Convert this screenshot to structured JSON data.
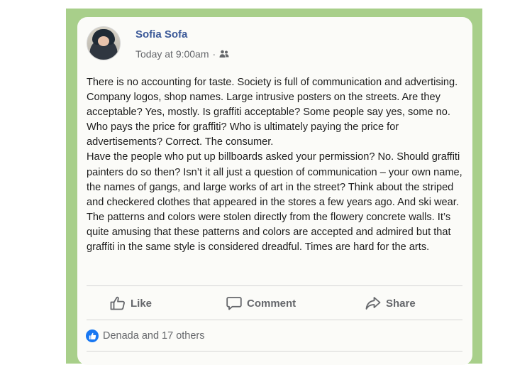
{
  "post": {
    "author": "Sofia Sofa",
    "timestamp": "Today at 9:00am",
    "audience_icon": "friends-icon",
    "paragraphs": [
      "There is no accounting for taste. Society is full of communication and advertising. Company logos, shop names. Large intrusive posters on the streets. Are they acceptable? Yes, mostly. Is graffiti acceptable? Some people say yes, some no. Who pays the price for graffiti? Who is ultimately paying the price for advertisements? Correct. The consumer.",
      "Have the people who put up billboards asked your permission? No. Should graffiti painters do so then? Isn’t it all just a question of communication – your own name, the names of gangs, and large works of art in the street? Think about the striped and checkered clothes that appeared in the stores a few years ago. And ski wear. The patterns and colors were stolen directly from the flowery concrete walls. It’s quite amusing that these patterns and colors are accepted and admired but that graffiti in the same style is considered dreadful. Times are hard for the arts."
    ]
  },
  "actions": {
    "like": "Like",
    "comment": "Comment",
    "share": "Share"
  },
  "reactions": {
    "summary": "Denada and 17 others"
  },
  "colors": {
    "frame": "#a8cf8a",
    "author": "#3b5998",
    "like_badge": "#1877f2"
  }
}
